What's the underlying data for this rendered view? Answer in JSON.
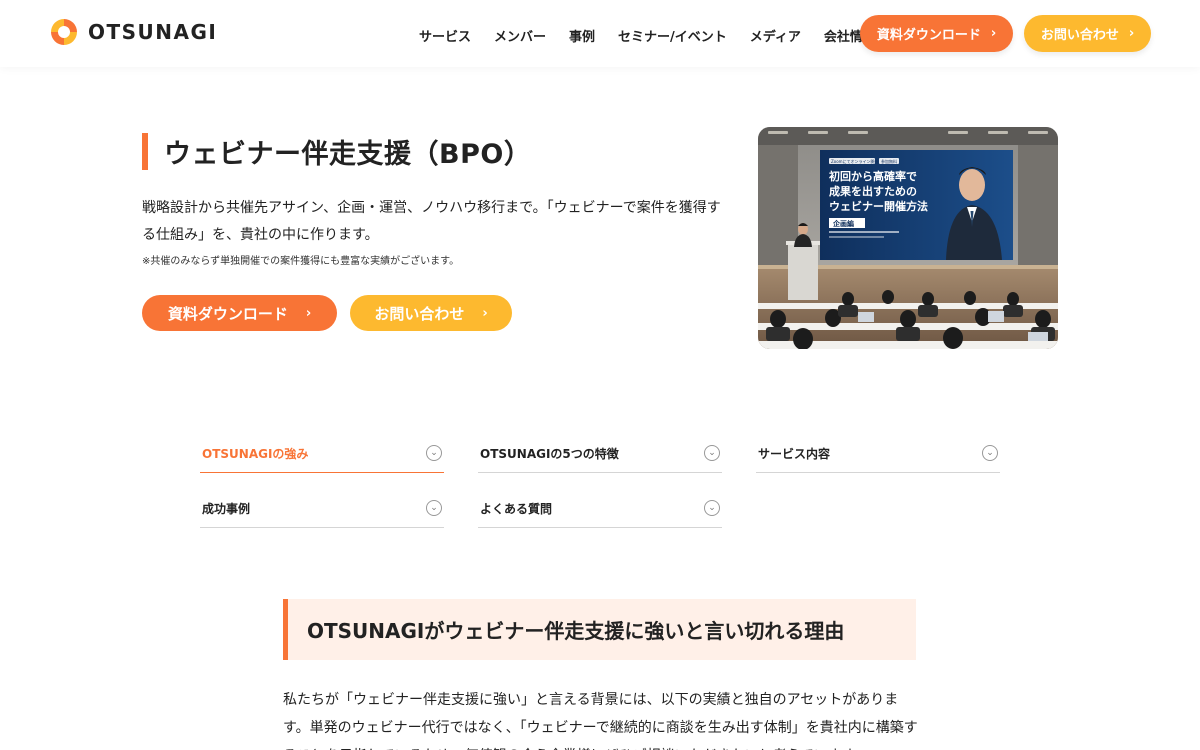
{
  "header": {
    "logo_text": "OTSUNAGI",
    "nav": [
      "サービス",
      "メンバー",
      "事例",
      "セミナー/イベント",
      "メディア",
      "会社情報"
    ],
    "download_label": "資料ダウンロード",
    "contact_label": "お問い合わせ"
  },
  "hero": {
    "title": "ウェビナー伴走支援（BPO）",
    "description": "戦略設計から共催先アサイン、企画・運営、ノウハウ移行まで。「ウェビナーで案件を獲得する仕組み」を、貴社の中に作ります。",
    "note": "※共催のみならず単独開催での案件獲得にも豊富な実績がございます。",
    "download_label": "資料ダウンロード",
    "contact_label": "お問い合わせ",
    "image": {
      "screen_badge_left": "Zoomにてオンライン開催",
      "screen_badge_right": "参加無料",
      "screen_title_line1": "初回から高確率で",
      "screen_title_line2": "成果を出すための",
      "screen_title_line3": "ウェビナー開催方法",
      "screen_tag": "企画編"
    }
  },
  "tabs": [
    {
      "label": "OTSUNAGIの強み",
      "active": true
    },
    {
      "label": "OTSUNAGIの5つの特徴",
      "active": false
    },
    {
      "label": "サービス内容",
      "active": false
    },
    {
      "label": "成功事例",
      "active": false
    },
    {
      "label": "よくある質問",
      "active": false
    }
  ],
  "section": {
    "title": "OTSUNAGIがウェビナー伴走支援に強いと言い切れる理由",
    "body": "私たちが「ウェビナー伴走支援に強い」と言える背景には、以下の実績と独自のアセットがあります。単発のウェビナー代行ではなく、「ウェビナーで継続的に商談を生み出す体制」を貴社内に構築することを目指しているため、価値観の合う企業様にぜひご相談いただきたいと考えています。"
  },
  "colors": {
    "orange": "#f87436",
    "yellow": "#fdb92f",
    "section_bg": "#fff0e8"
  }
}
